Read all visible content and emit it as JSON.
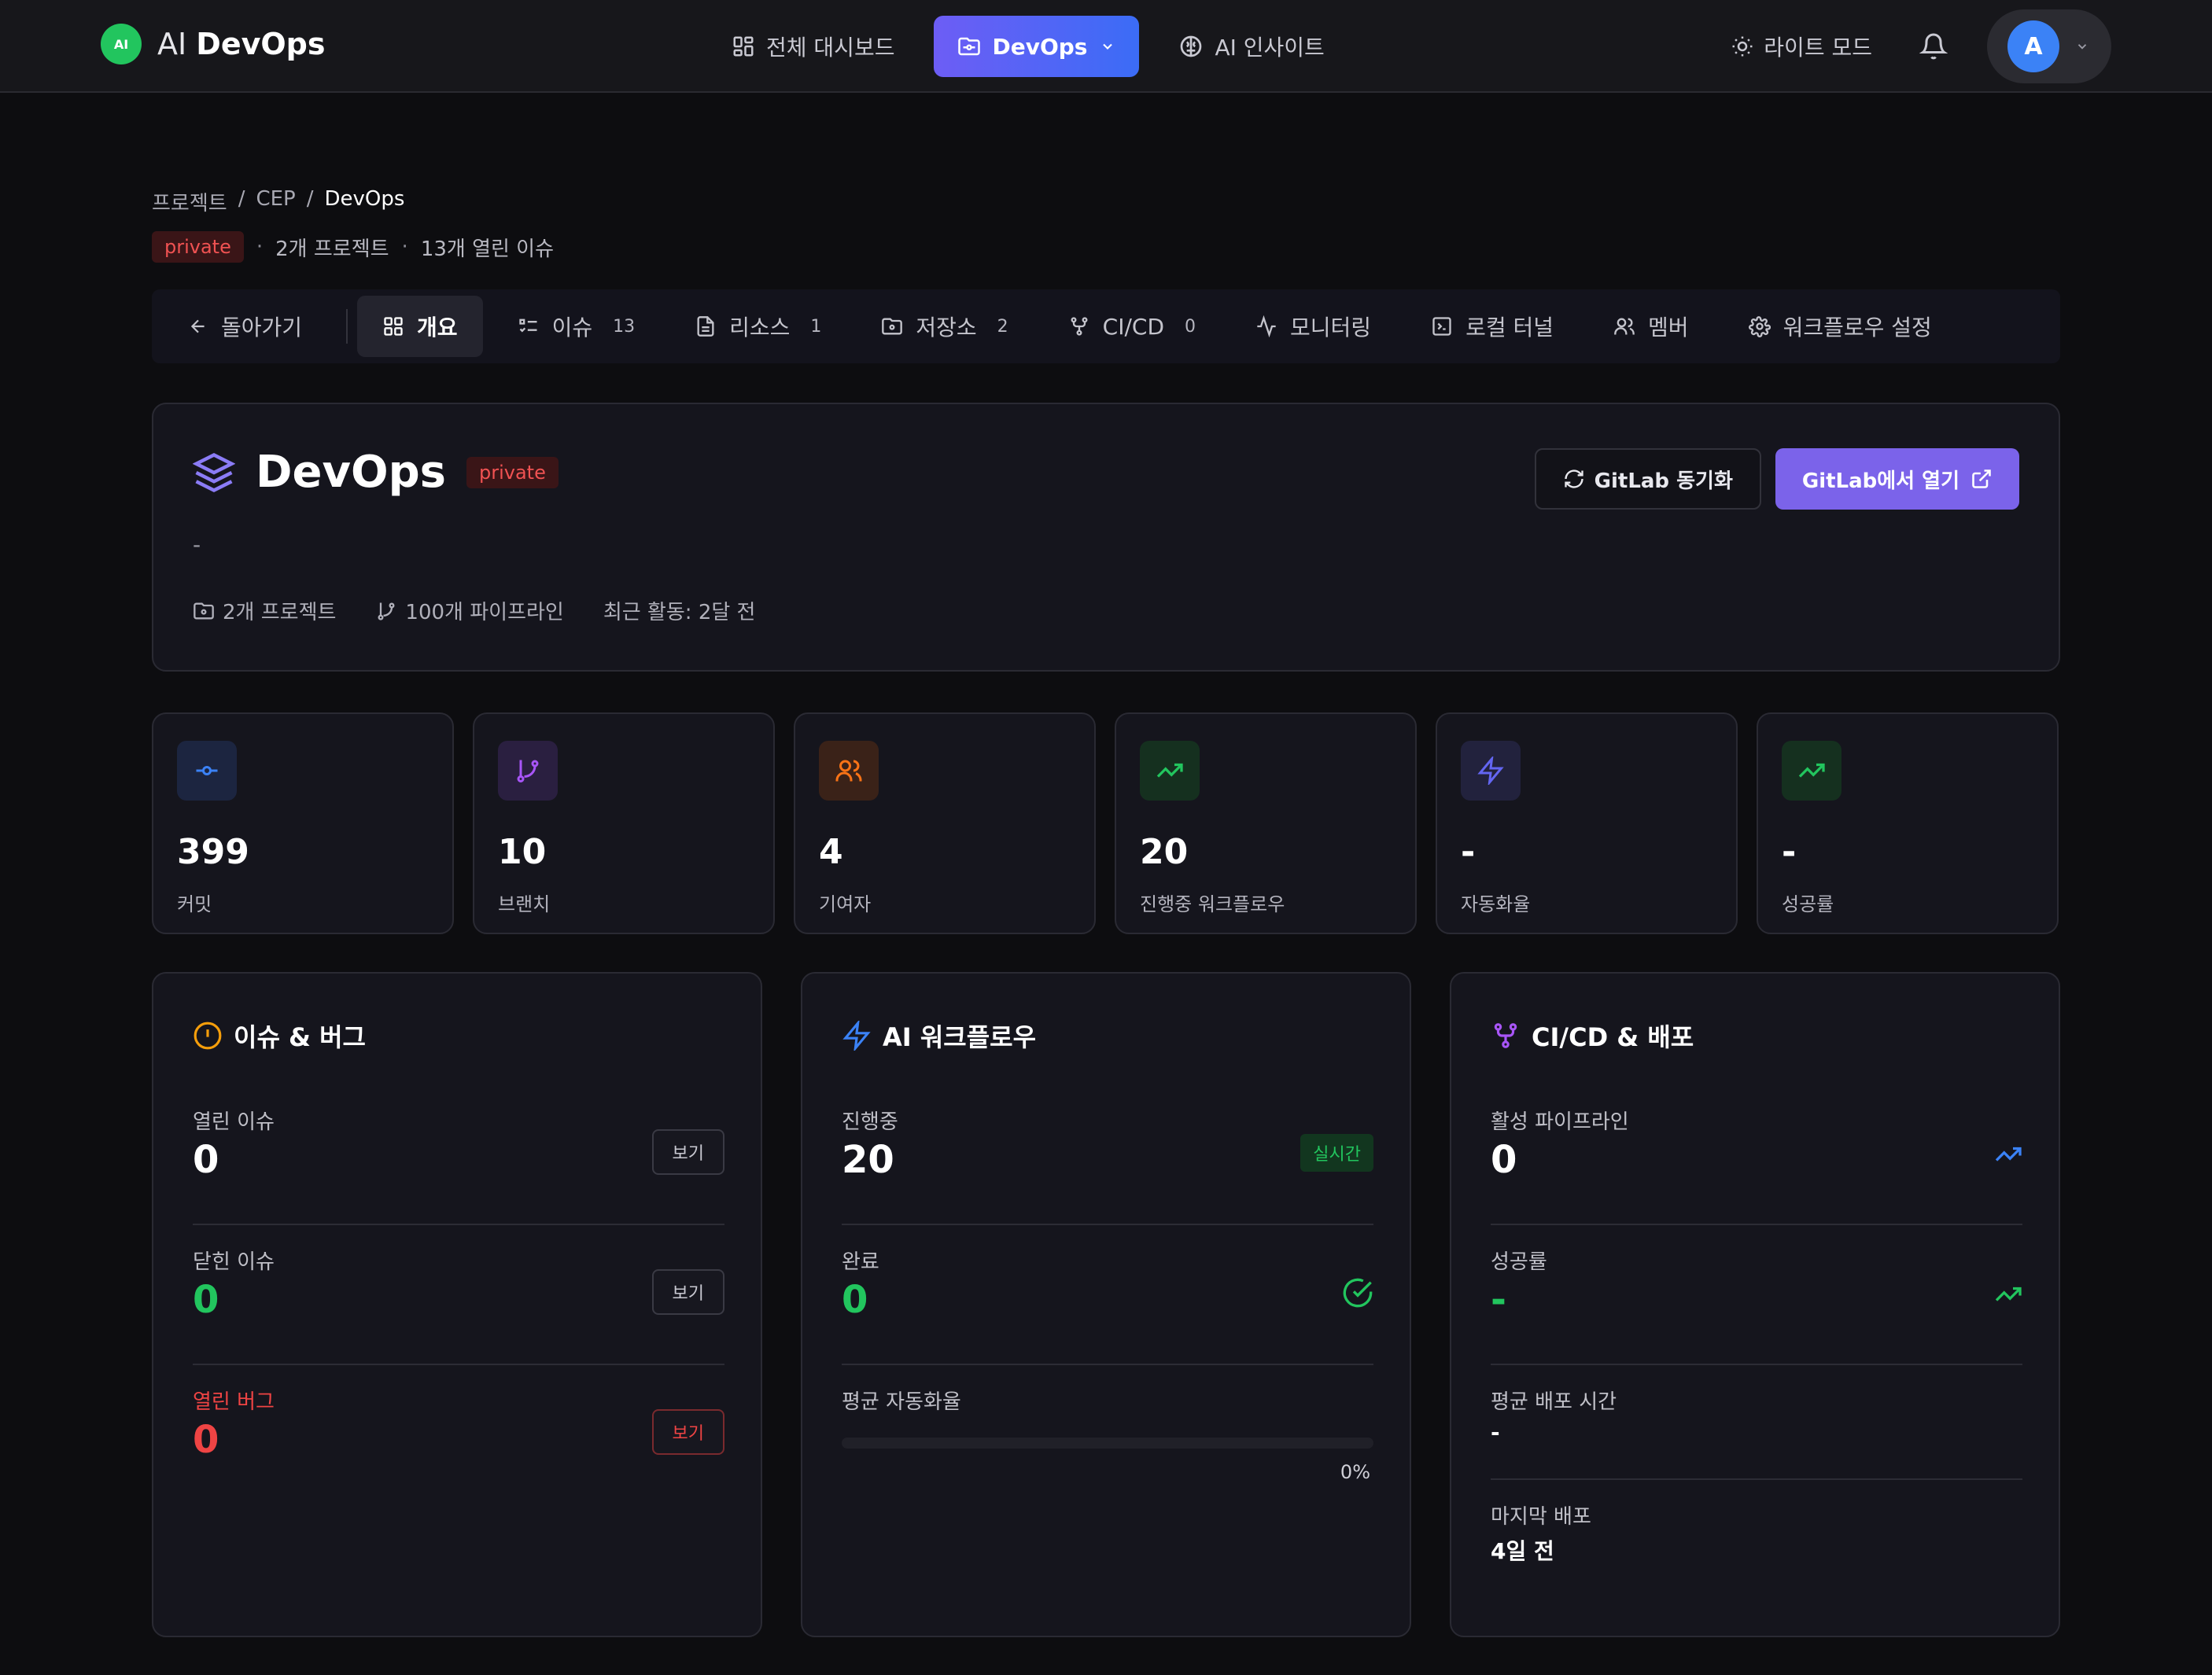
{
  "header": {
    "logo_text": "AI",
    "brand_light": "AI",
    "brand_bold": "DevOps",
    "nav": [
      {
        "label": "전체 대시보드",
        "icon": "dashboard-icon"
      },
      {
        "label": "DevOps",
        "icon": "folder-git-icon",
        "active": true
      },
      {
        "label": "AI 인사이트",
        "icon": "brain-icon"
      }
    ],
    "theme_toggle_label": "라이트 모드",
    "avatar_initial": "A"
  },
  "breadcrumb": {
    "items": [
      "프로젝트",
      "CEP",
      "DevOps"
    ],
    "separator": "/"
  },
  "meta": {
    "visibility": "private",
    "projects": "2개 프로젝트",
    "open_issues": "13개 열린 이슈"
  },
  "tabs": {
    "back": "돌아가기",
    "items": [
      {
        "label": "개요",
        "icon": "grid-icon",
        "count": "",
        "active": true
      },
      {
        "label": "이슈",
        "icon": "list-check-icon",
        "count": "13"
      },
      {
        "label": "리소스",
        "icon": "file-icon",
        "count": "1"
      },
      {
        "label": "저장소",
        "icon": "folder-git-icon",
        "count": "2"
      },
      {
        "label": "CI/CD",
        "icon": "git-fork-icon",
        "count": "0"
      },
      {
        "label": "모니터링",
        "icon": "activity-icon",
        "count": ""
      },
      {
        "label": "로컬 터널",
        "icon": "terminal-icon",
        "count": ""
      },
      {
        "label": "멤버",
        "icon": "users-icon",
        "count": ""
      },
      {
        "label": "워크플로우 설정",
        "icon": "settings-icon",
        "count": ""
      }
    ]
  },
  "project": {
    "name": "DevOps",
    "visibility": "private",
    "description": "-",
    "projects": "2개 프로젝트",
    "pipelines": "100개 파이프라인",
    "last_activity": "최근 활동: 2달 전",
    "sync_label": "GitLab 동기화",
    "open_label": "GitLab에서 열기"
  },
  "stats": [
    {
      "value": "399",
      "label": "커밋",
      "icon": "commit-icon",
      "color": "#3b82f6",
      "bg": "#1c2540"
    },
    {
      "value": "10",
      "label": "브랜치",
      "icon": "git-branch-icon",
      "color": "#a855f7",
      "bg": "#2a1f40"
    },
    {
      "value": "4",
      "label": "기여자",
      "icon": "users-icon",
      "color": "#f97316",
      "bg": "#3a2218"
    },
    {
      "value": "20",
      "label": "진행중 워크플로우",
      "icon": "trending-up-icon",
      "color": "#22c55e",
      "bg": "#15301f"
    },
    {
      "value": "-",
      "label": "자동화율",
      "icon": "zap-icon",
      "color": "#6366f1",
      "bg": "#22223d"
    },
    {
      "value": "-",
      "label": "성공률",
      "icon": "trending-up-icon",
      "color": "#22c55e",
      "bg": "#15301f"
    }
  ],
  "issues_panel": {
    "title": "이슈 & 버그",
    "open_label": "열린 이슈",
    "open_value": "0",
    "closed_label": "닫힌 이슈",
    "closed_value": "0",
    "bugs_label": "열린 버그",
    "bugs_value": "0",
    "view_label": "보기"
  },
  "workflow_panel": {
    "title": "AI 워크플로우",
    "running_label": "진행중",
    "running_value": "20",
    "live_badge": "실시간",
    "done_label": "완료",
    "done_value": "0",
    "automation_label": "평균 자동화율",
    "automation_pct": "0%",
    "automation_fraction": 0
  },
  "cicd_panel": {
    "title": "CI/CD & 배포",
    "active_label": "활성 파이프라인",
    "active_value": "0",
    "success_label": "성공률",
    "success_value": "-",
    "avg_label": "평균 배포 시간",
    "avg_value": "-",
    "last_label": "마지막 배포",
    "last_value": "4일 전"
  },
  "colors": {
    "accent": "#7b63ea",
    "success": "#22c55e",
    "danger": "#ef4444",
    "warning": "#f59e0b"
  }
}
